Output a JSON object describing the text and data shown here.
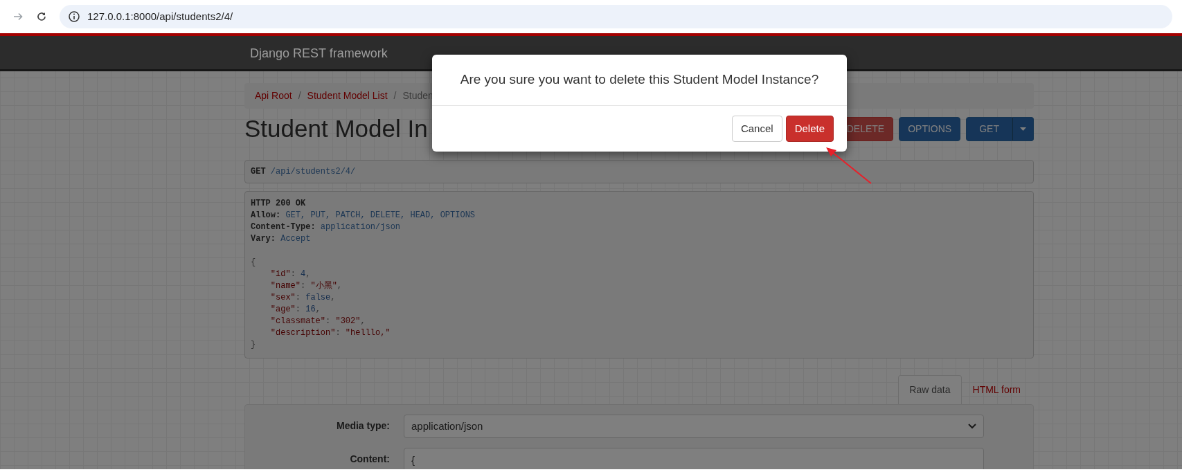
{
  "browser": {
    "url": "127.0.0.1:8000/api/students2/4/"
  },
  "navbar": {
    "brand": "Django REST framework"
  },
  "breadcrumb": {
    "items": [
      {
        "label": "Api Root",
        "kind": "link"
      },
      {
        "label": "Student Model List",
        "kind": "link"
      },
      {
        "label": "Studen",
        "kind": "current"
      }
    ],
    "separators": [
      "/",
      "/"
    ]
  },
  "title": "Student Model In",
  "actions": [
    {
      "label": "DELETE",
      "kind": "danger",
      "dropdown": false
    },
    {
      "label": "OPTIONS",
      "kind": "primary",
      "dropdown": false
    },
    {
      "label": "GET",
      "kind": "primary",
      "dropdown": true
    }
  ],
  "request": {
    "method": "GET",
    "path": "/api/students2/4/"
  },
  "response": {
    "status": "HTTP 200 OK",
    "headers": [
      {
        "name": "Allow:",
        "value": "GET, PUT, PATCH, DELETE, HEAD, OPTIONS"
      },
      {
        "name": "Content-Type:",
        "value": "application/json"
      },
      {
        "name": "Vary:",
        "value": "Accept"
      }
    ],
    "open": "{",
    "fields": [
      {
        "key": "\"id\"",
        "sep": ": ",
        "value": "4",
        "kind": "number",
        "end": ","
      },
      {
        "key": "\"name\"",
        "sep": ": ",
        "value": "\"小黑\"",
        "kind": "string",
        "end": ","
      },
      {
        "key": "\"sex\"",
        "sep": ": ",
        "value": "false",
        "kind": "literal",
        "end": ","
      },
      {
        "key": "\"age\"",
        "sep": ": ",
        "value": "16",
        "kind": "number",
        "end": ","
      },
      {
        "key": "\"classmate\"",
        "sep": ": ",
        "value": "\"302\"",
        "kind": "string",
        "end": ","
      },
      {
        "key": "\"description\"",
        "sep": ": ",
        "value": "\"helllo,\"",
        "kind": "string"
      }
    ],
    "close": "}"
  },
  "tabs": [
    {
      "label": "Raw data",
      "selected": true
    },
    {
      "label": "HTML form",
      "selected": false
    }
  ],
  "form": {
    "fields": [
      {
        "label": "Media type:",
        "kind": "select",
        "value": "application/json"
      },
      {
        "label": "Content:",
        "kind": "textarea",
        "value": "{"
      }
    ]
  },
  "modal": {
    "message": "Are you sure you want to delete this Student Model Instance?",
    "buttons": [
      {
        "label": "Cancel",
        "kind": "default"
      },
      {
        "label": "Delete",
        "kind": "danger"
      }
    ]
  }
}
